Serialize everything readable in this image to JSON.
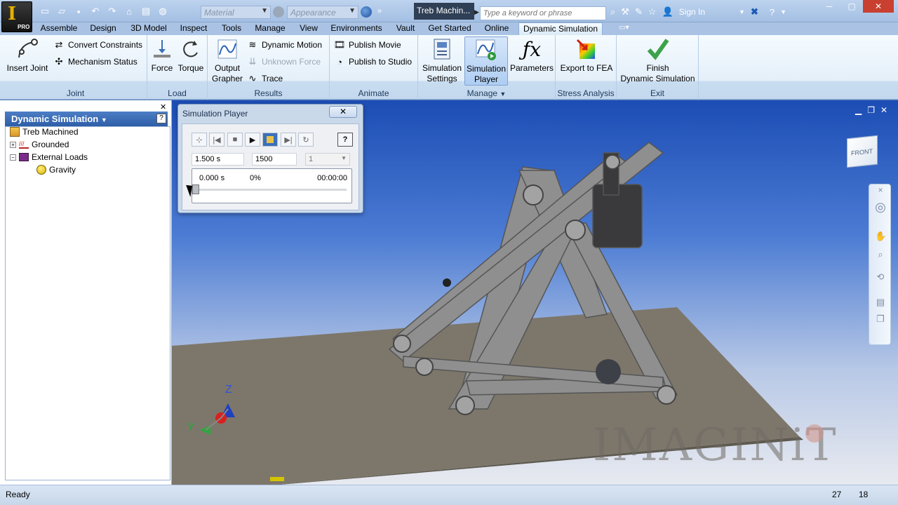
{
  "app": {
    "logo_letter": "I",
    "edition": "PRO"
  },
  "title_bar": {
    "material_placeholder": "Material",
    "appearance_placeholder": "Appearance",
    "document_title": "Treb Machin...",
    "search_placeholder": "Type a keyword or phrase",
    "sign_in": "Sign In"
  },
  "tabs": [
    "Assemble",
    "Design",
    "3D Model",
    "Inspect",
    "Tools",
    "Manage",
    "View",
    "Environments",
    "Vault",
    "Get Started",
    "Online",
    "Dynamic Simulation"
  ],
  "active_tab": "Dynamic Simulation",
  "ribbon": {
    "joint": {
      "label": "Joint",
      "insert_joint": "Insert Joint",
      "convert_constraints": "Convert Constraints",
      "mechanism_status": "Mechanism Status"
    },
    "load": {
      "label": "Load",
      "force": "Force",
      "torque": "Torque"
    },
    "results": {
      "label": "Results",
      "output_grapher": [
        "Output",
        "Grapher"
      ],
      "dynamic_motion": "Dynamic Motion",
      "unknown_force": "Unknown Force",
      "trace": "Trace"
    },
    "animate": {
      "label": "Animate",
      "publish_movie": "Publish Movie",
      "publish_studio": "Publish to Studio"
    },
    "manage": {
      "label": "Manage",
      "sim_settings": [
        "Simulation",
        "Settings"
      ],
      "sim_player": [
        "Simulation",
        "Player"
      ],
      "parameters": "Parameters"
    },
    "stress": {
      "label": "Stress Analysis",
      "export_fea": "Export to FEA"
    },
    "exit": {
      "label": "Exit",
      "finish": [
        "Finish",
        "Dynamic Simulation"
      ]
    }
  },
  "browser": {
    "title": "Dynamic Simulation",
    "tree": [
      {
        "label": "Treb Machined",
        "level": 0
      },
      {
        "label": "Grounded",
        "level": 1,
        "expander": "+"
      },
      {
        "label": "External Loads",
        "level": 1,
        "expander": "−"
      },
      {
        "label": "Gravity",
        "level": 2
      }
    ]
  },
  "sim_player": {
    "title": "Simulation Player",
    "close": "✕",
    "final_time": "1.500 s",
    "images": "1500",
    "filter": "1",
    "current_time": "0.000 s",
    "percent": "0%",
    "elapsed": "00:00:00",
    "progress": 0
  },
  "viewcube": {
    "face": "FRONT"
  },
  "axes": {
    "z": "Z",
    "y": "Y"
  },
  "watermark": "IMAGINiT",
  "status": {
    "text": "Ready",
    "n1": "27",
    "n2": "18"
  },
  "colors": {
    "accent": "#3da24a",
    "browser_header": "#2d5ea8",
    "close_red": "#c94030"
  }
}
